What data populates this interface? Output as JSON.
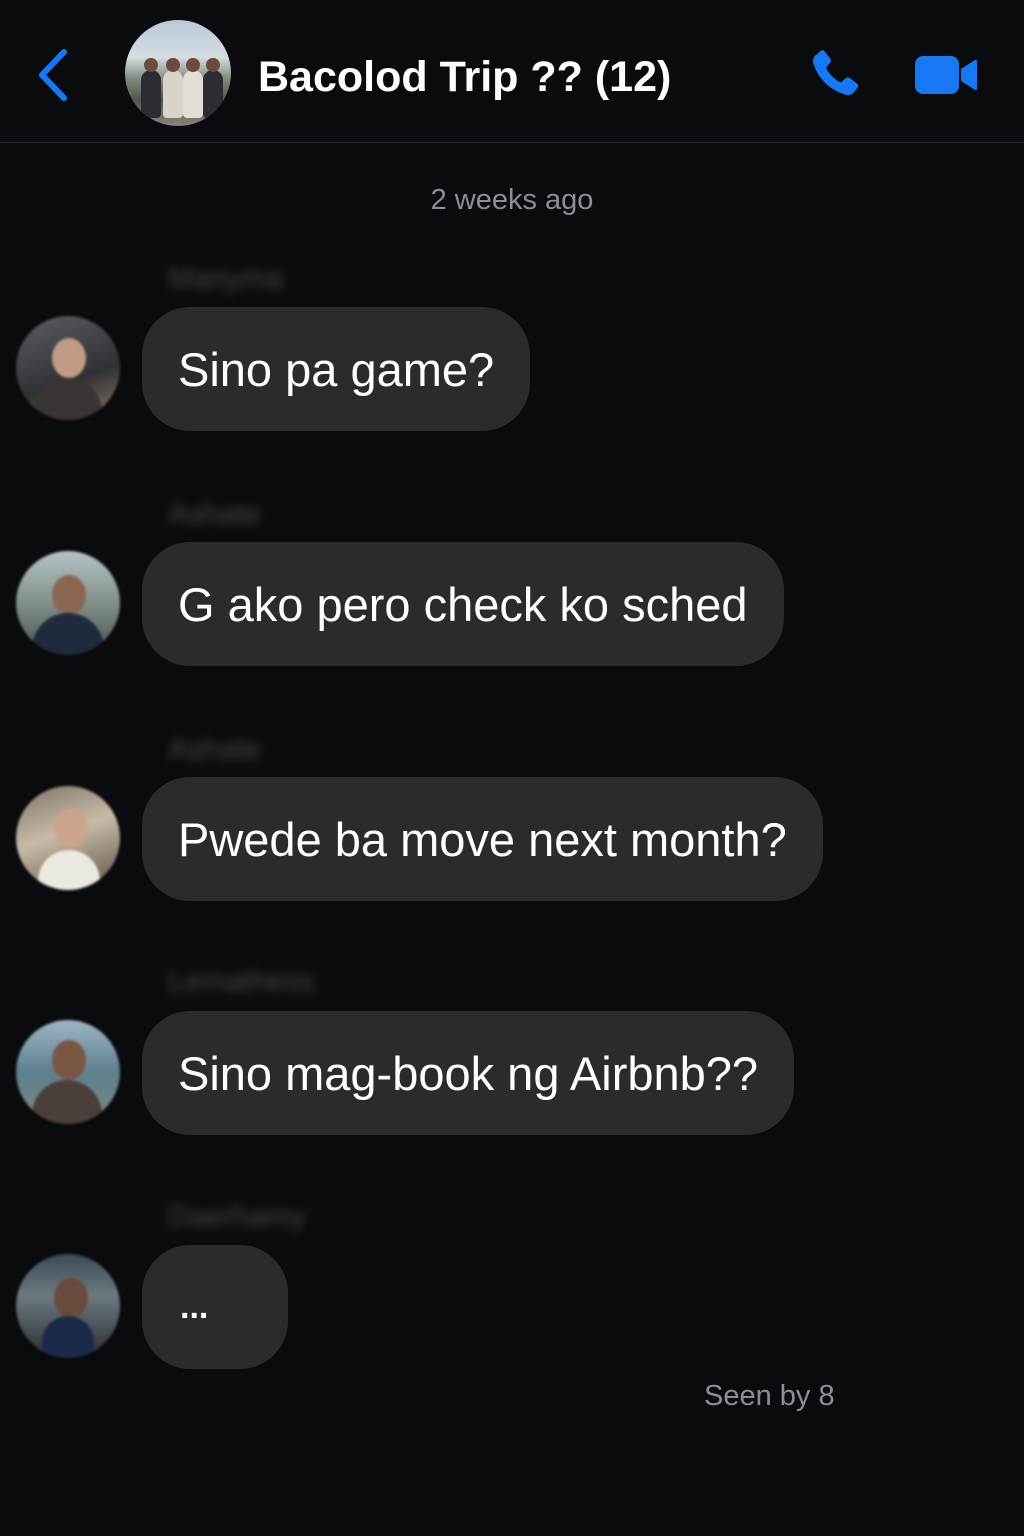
{
  "header": {
    "title": "Bacolod Trip ?? (12)",
    "back_icon": "chevron-left-icon",
    "call_icon": "phone-icon",
    "video_icon": "video-camera-icon",
    "accent_color": "#1877f2"
  },
  "conversation": {
    "timestamp": "2 weeks ago",
    "messages": [
      {
        "text": "Sino pa game?"
      },
      {
        "text": "G ako pero check ko sched"
      },
      {
        "text": "Pwede ba move next month?"
      },
      {
        "text": "Sino mag-book ng Airbnb??"
      },
      {
        "text": "..."
      }
    ],
    "seen_status": "Seen by 8"
  },
  "colors": {
    "background": "#0a0b0e",
    "bubble": "#2a2b2f",
    "secondary_text": "#8d8e93"
  }
}
